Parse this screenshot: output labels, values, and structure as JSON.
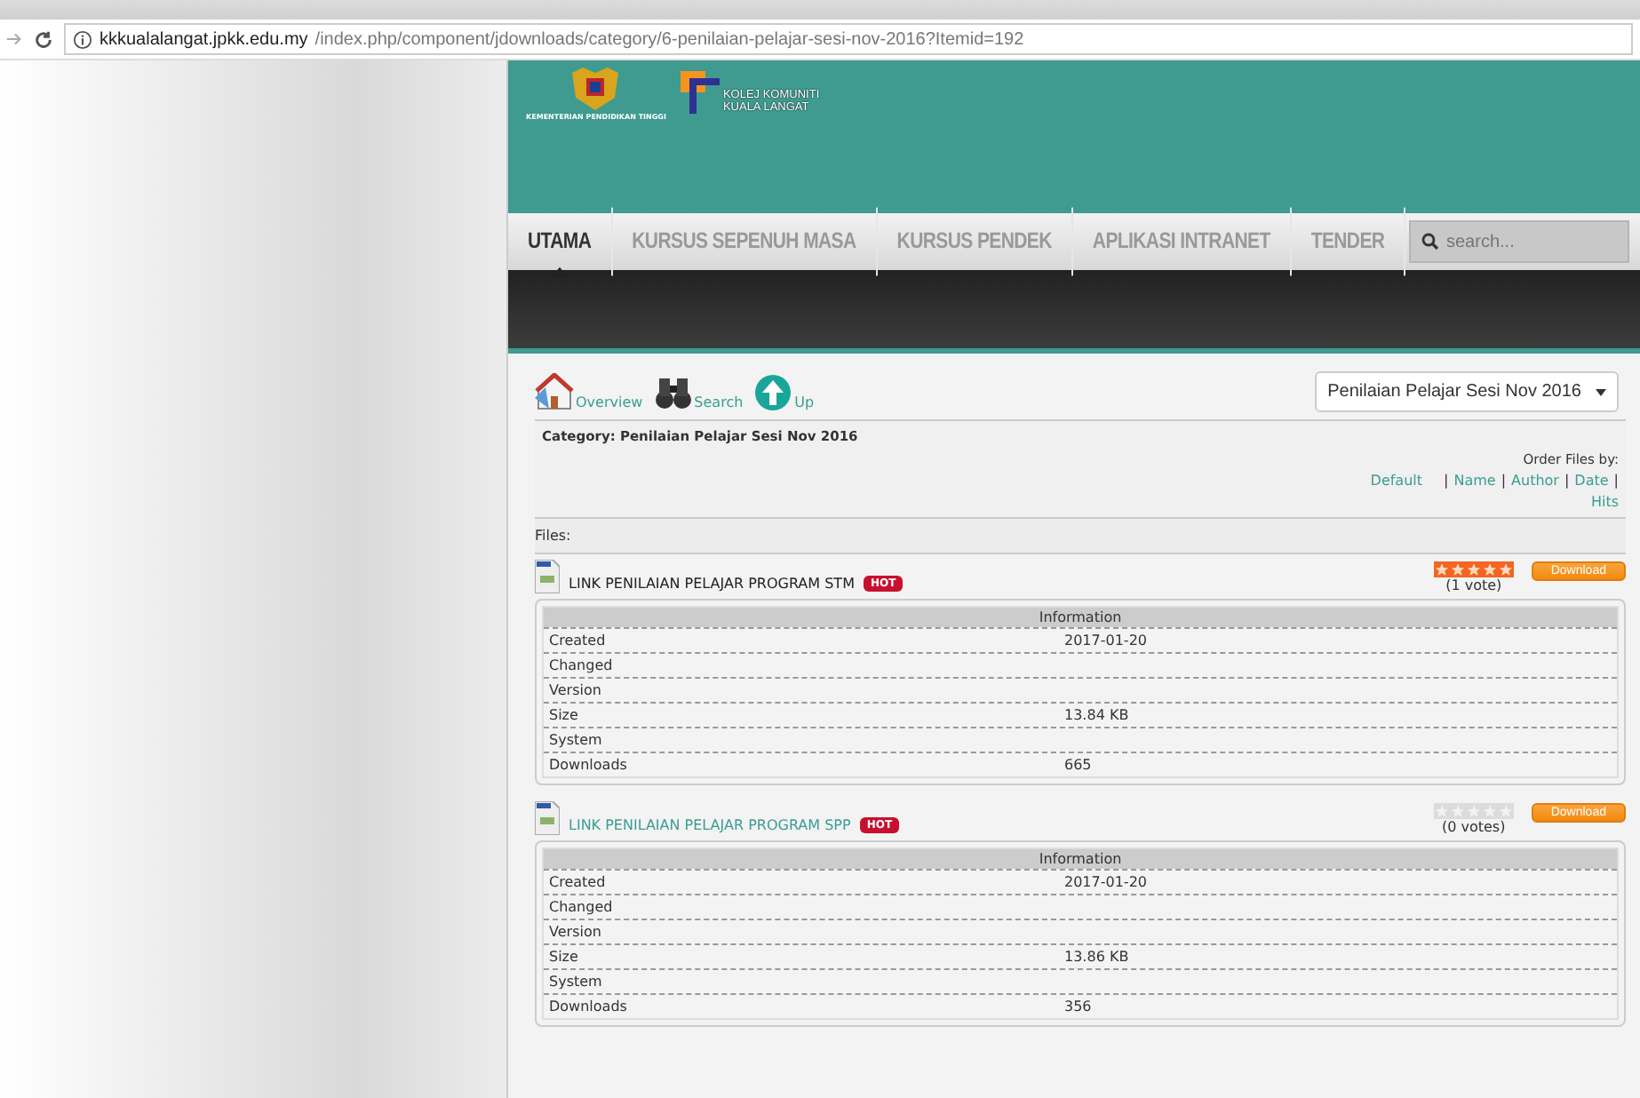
{
  "browser": {
    "url_host": "kkkualalangat.jpkk.edu.my",
    "url_path": "/index.php/component/jdownloads/category/6-penilaian-pelajar-sesi-nov-2016?Itemid=192"
  },
  "header": {
    "ministry_caption": "KEMENTERIAN PENDIDIKAN TINGGI",
    "college_name": [
      "KOLEJ KOMUNITI",
      "KUALA LANGAT"
    ]
  },
  "nav": {
    "items": [
      {
        "label": "UTAMA",
        "selected": true
      },
      {
        "label": "KURSUS SEPENUH MASA",
        "selected": false
      },
      {
        "label": "KURSUS PENDEK",
        "selected": false
      },
      {
        "label": "APLIKASI INTRANET",
        "selected": false
      },
      {
        "label": "TENDER",
        "selected": false
      }
    ],
    "search_placeholder": "search..."
  },
  "toolbar": {
    "links": [
      {
        "kind": "overview",
        "label": "Overview"
      },
      {
        "kind": "search",
        "label": "Search"
      },
      {
        "kind": "up",
        "label": "Up"
      }
    ],
    "category_select": "Penilaian Pelajar Sesi Nov 2016"
  },
  "category": {
    "title": "Category: Penilaian Pelajar Sesi Nov 2016",
    "order_label": "Order Files by:",
    "order_links": [
      "Default",
      "Name",
      "Author",
      "Date",
      "Hits"
    ],
    "separator": "|"
  },
  "files_label": "Files:",
  "files": [
    {
      "title": "LINK PENILAIAN PELAJAR PROGRAM STM",
      "hovered": true,
      "badge": "HOT",
      "stars": 5,
      "votes": "(1 vote)",
      "download": "Download",
      "info_title": "Information",
      "rows": [
        {
          "label": "Created",
          "value": "2017-01-20"
        },
        {
          "label": "Changed"
        },
        {
          "label": "Version"
        },
        {
          "label": "Size",
          "value": "13.84 KB"
        },
        {
          "label": "System"
        },
        {
          "label": "Downloads",
          "value": "665"
        }
      ]
    },
    {
      "title": "LINK PENILAIAN PELAJAR PROGRAM SPP",
      "hovered": false,
      "badge": "HOT",
      "stars": 0,
      "votes": "(0 votes)",
      "download": "Download",
      "info_title": "Information",
      "rows": [
        {
          "label": "Created",
          "value": "2017-01-20"
        },
        {
          "label": "Changed"
        },
        {
          "label": "Version"
        },
        {
          "label": "Size",
          "value": "13.86 KB"
        },
        {
          "label": "System"
        },
        {
          "label": "Downloads",
          "value": "356"
        }
      ]
    }
  ]
}
